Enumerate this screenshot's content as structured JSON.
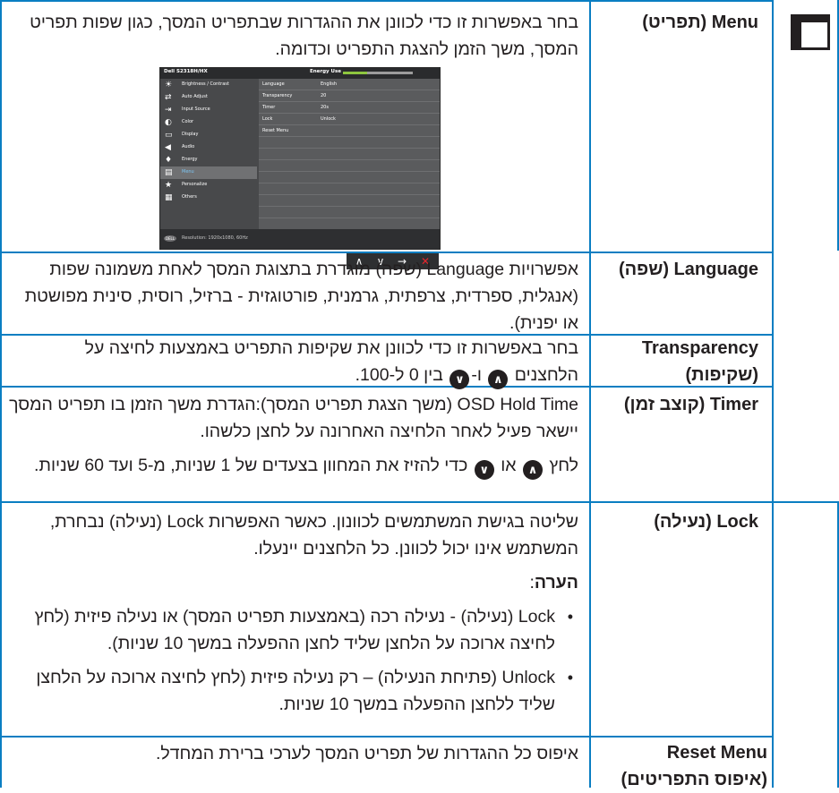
{
  "menu_icon_name": "osd-menu-icon",
  "rows": {
    "menu": {
      "name": "Menu (תפריט)",
      "desc": "בחר באפשרות זו כדי לכוונן את ההגדרות שבתפריט המסך, כגון שפות תפריט המסך, משך הזמן להצגת התפריט וכדומה."
    },
    "language": {
      "name": "Language (שפה)",
      "desc": "אפשרויות Language (שפה) מוגדרת בתצוגת המסך לאחת משמונה שפות (אנגלית, ספרדית, צרפתית, גרמנית, פורטוגזית - ברזיל, רוסית, סינית מפושטת או יפנית)."
    },
    "transparency": {
      "name_line1": "Transparency",
      "name_line2": "(שקיפות)",
      "desc_line1": "בחר באפשרות זו כדי לכוונן את שקיפות התפריט באמצעות לחיצה על",
      "desc_pre": "הלחצנים",
      "desc_and": "ו-",
      "desc_post": "בין 0 ל-100."
    },
    "timer": {
      "name": "Timer (קוצב זמן)",
      "desc": "OSD Hold Time (משך הצגת תפריט המסך):הגדרת משך הזמן בו תפריט המסך יישאר פעיל לאחר הלחיצה האחרונה על לחצן כלשהו.",
      "desc2_pre": "לחץ",
      "desc2_or": "או",
      "desc2_post": "כדי להזיז את המחוון בצעדים של 1 שניות, מ-5 ועד 60 שניות."
    },
    "lock": {
      "name": "Lock (נעילה)",
      "desc": "שליטה בגישת המשתמשים לכוונון. כאשר האפשרות Lock (נעילה) נבחרת, המשתמש אינו יכול לכוונן. כל הלחצנים יינעלו.",
      "note_label": "הערה",
      "note_colon": ":",
      "bullets": [
        "Lock (נעילה) - נעילה רכה (באמצעות תפריט המסך) או נעילה פיזית (לחץ לחיצה ארוכה על הלחצן שליד לחצן ההפעלה במשך 10 שניות).",
        "Unlock (פתיחת הנעילה) – רק נעילה פיזית (לחץ לחיצה ארוכה על הלחצן שליד ללחצן ההפעלה במשך 10 שניות."
      ]
    },
    "reset": {
      "name_line1": "Reset Menu",
      "name_line2": "(איפוס התפריטים)",
      "desc": "איפוס כל ההגדרות של תפריט המסך לערכי ברירת המחדל."
    }
  },
  "osd": {
    "model": "Dell S2318H/HX",
    "energy_label": "Energy Use",
    "energy_level": 0.35,
    "menu_items": [
      {
        "icon": "brightness-icon",
        "glyph": "☀",
        "label": "Brightness / Contrast"
      },
      {
        "icon": "auto-adjust-icon",
        "glyph": "⇄",
        "label": "Auto Adjust"
      },
      {
        "icon": "input-source-icon",
        "glyph": "⇥",
        "label": "Input Source"
      },
      {
        "icon": "color-icon",
        "glyph": "◐",
        "label": "Color"
      },
      {
        "icon": "display-icon",
        "glyph": "▭",
        "label": "Display"
      },
      {
        "icon": "audio-icon",
        "glyph": "◀",
        "label": "Audio"
      },
      {
        "icon": "energy-icon",
        "glyph": "♦",
        "label": "Energy"
      },
      {
        "icon": "menu-icon",
        "glyph": "▤",
        "label": "Menu"
      },
      {
        "icon": "personalize-icon",
        "glyph": "★",
        "label": "Personalize"
      },
      {
        "icon": "others-icon",
        "glyph": "▦",
        "label": "Others"
      }
    ],
    "settings": [
      {
        "key": "Language",
        "value": "English"
      },
      {
        "key": "Transparency",
        "value": "20"
      },
      {
        "key": "Timer",
        "value": "20s"
      },
      {
        "key": "Lock",
        "value": "Unlock"
      },
      {
        "key": "Reset Menu",
        "value": ""
      }
    ],
    "logo_text": "DELL",
    "resolution": "Resolution: 1920x1080, 60Hz",
    "buttons": [
      "∧",
      "∨",
      "→",
      "✕"
    ]
  },
  "button_glyphs": {
    "up": "∧",
    "down": "∨"
  },
  "colors": {
    "rule": "#0a7ec2",
    "osd_background": "#48494b",
    "osd_selection": "#707173",
    "close_red": "#e3262d",
    "energy_green": "#8ec63f"
  }
}
